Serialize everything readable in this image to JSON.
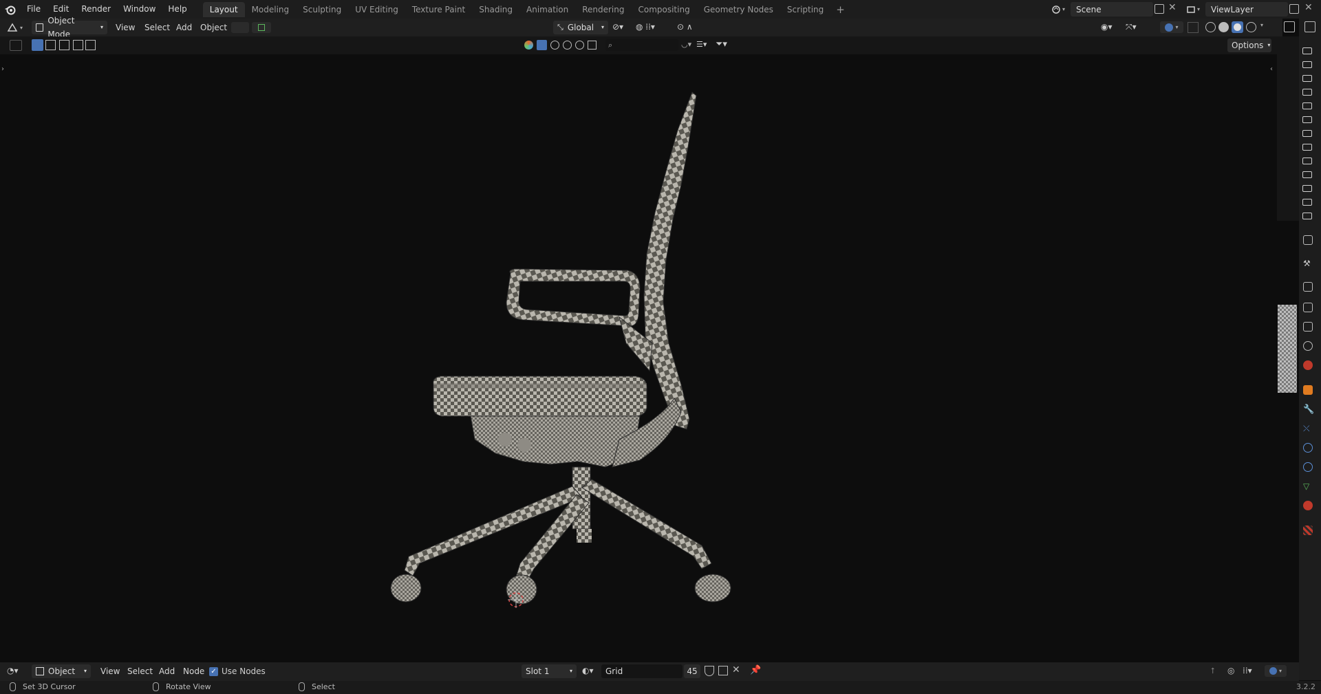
{
  "menu": {
    "file": "File",
    "edit": "Edit",
    "render": "Render",
    "window": "Window",
    "help": "Help"
  },
  "workspaces": [
    {
      "label": "Layout",
      "active": true
    },
    {
      "label": "Modeling"
    },
    {
      "label": "Sculpting"
    },
    {
      "label": "UV Editing"
    },
    {
      "label": "Texture Paint"
    },
    {
      "label": "Shading"
    },
    {
      "label": "Animation"
    },
    {
      "label": "Rendering"
    },
    {
      "label": "Compositing"
    },
    {
      "label": "Geometry Nodes"
    },
    {
      "label": "Scripting"
    }
  ],
  "workspace_add": "+",
  "scene": {
    "name": "Scene"
  },
  "view_layer": {
    "name": "ViewLayer"
  },
  "viewport_header": {
    "mode": "Object Mode",
    "view": "View",
    "select": "Select",
    "add": "Add",
    "object": "Object",
    "transform_orientation": "Global",
    "options": "Options"
  },
  "node_header": {
    "editor_type": "Object",
    "view": "View",
    "select": "Select",
    "add": "Add",
    "node": "Node",
    "use_nodes_label": "Use Nodes",
    "use_nodes_checked": true,
    "slot": "Slot 1",
    "material_name": "Grid",
    "user_count": "45"
  },
  "status_bar": {
    "left_action": "Set 3D Cursor",
    "middle_action": "Rotate View",
    "right_action": "Select",
    "version": "3.2.2"
  },
  "colors": {
    "accent": "#4772b3",
    "background": "#0d0d0d",
    "header": "#1f1f1f",
    "cursor_ring": "#d04040"
  },
  "icons": [
    "blender-logo-icon",
    "camera-icon",
    "properties-wrench-icon",
    "material-icon",
    "world-icon",
    "object-icon",
    "hand-pan-icon",
    "zoom-icon",
    "filter-icon",
    "search-icon"
  ]
}
